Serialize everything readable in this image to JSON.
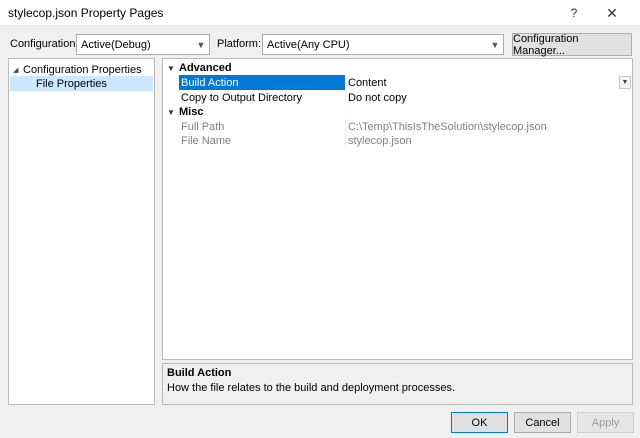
{
  "window": {
    "title": "stylecop.json Property Pages",
    "help_glyph": "?",
    "close_glyph": "✕"
  },
  "config_row": {
    "configuration_label": "Configuration:",
    "configuration_value": "Active(Debug)",
    "platform_label": "Platform:",
    "platform_value": "Active(Any CPU)",
    "config_manager_label": "Configuration Manager..."
  },
  "tree": {
    "items": [
      {
        "label": "Configuration Properties",
        "expanded": true,
        "selected": false
      },
      {
        "label": "File Properties",
        "selected": true
      }
    ]
  },
  "grid": {
    "categories": [
      {
        "name": "Advanced",
        "properties": [
          {
            "name": "Build Action",
            "value": "Content",
            "selected": true
          },
          {
            "name": "Copy to Output Directory",
            "value": "Do not copy"
          }
        ]
      },
      {
        "name": "Misc",
        "properties": [
          {
            "name": "Full Path",
            "value": "C:\\Temp\\ThisIsTheSolution\\stylecop.json",
            "readonly": true
          },
          {
            "name": "File Name",
            "value": "stylecop.json",
            "readonly": true
          }
        ]
      }
    ]
  },
  "description": {
    "title": "Build Action",
    "text": "How the file relates to the build and deployment processes."
  },
  "buttons": {
    "ok": "OK",
    "cancel": "Cancel",
    "apply": "Apply"
  },
  "colors": {
    "selection": "#0078d7",
    "tree_selection": "#cce8ff"
  }
}
